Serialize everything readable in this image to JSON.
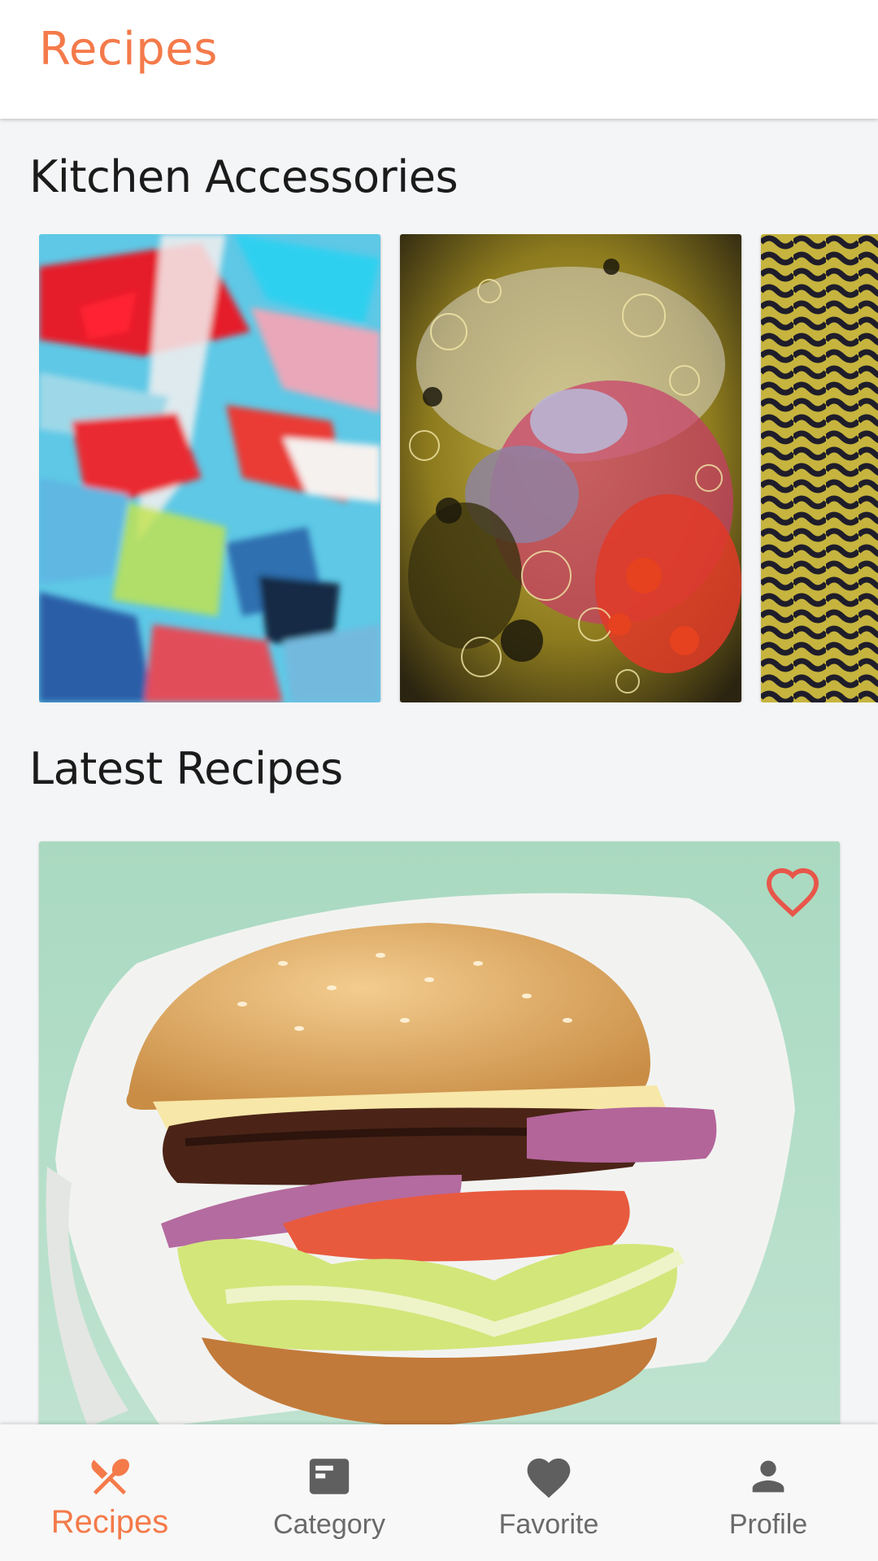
{
  "colors": {
    "accent": "#f47a4a",
    "icon_inactive": "#5f5f5f",
    "favorite": "#e8564a"
  },
  "app_bar": {
    "title": "Recipes"
  },
  "sections": {
    "accessories_title": "Kitchen Accessories",
    "latest_title": "Latest Recipes"
  },
  "accessories": [
    {
      "name": "abstract-paint-image"
    },
    {
      "name": "oil-bubbles-image"
    },
    {
      "name": "gold-pattern-image"
    }
  ],
  "latest_recipe": {
    "image": "burger-image",
    "favorite_icon": "heart-outline-icon"
  },
  "bottom_nav": {
    "active_index": 0,
    "items": [
      {
        "label": "Recipes",
        "icon": "fork-knife-icon"
      },
      {
        "label": "Category",
        "icon": "category-card-icon"
      },
      {
        "label": "Favorite",
        "icon": "heart-icon"
      },
      {
        "label": "Profile",
        "icon": "person-icon"
      }
    ]
  }
}
